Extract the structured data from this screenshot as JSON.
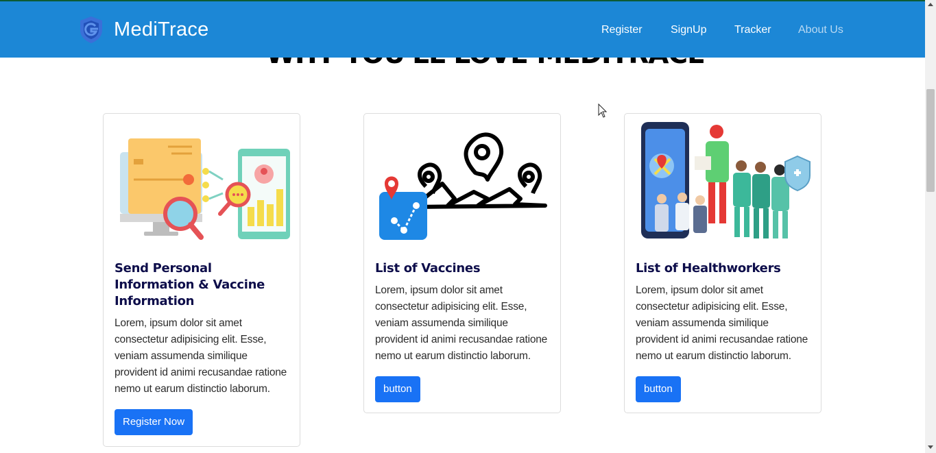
{
  "brand": {
    "name": "MediTrace",
    "logo_icon": "shield-g-logo-icon"
  },
  "nav": {
    "register": "Register",
    "signup": "SignUp",
    "tracker": "Tracker",
    "about": "About Us"
  },
  "section": {
    "heading": "WHY YOU'LL LOVE MEDITRACE"
  },
  "cards": [
    {
      "image_icon": "personal-info-illustration",
      "title": "Send Personal Information & Vaccine Information",
      "text": "Lorem, ipsum dolor sit amet consectetur adipisicing elit. Esse, veniam assumenda similique provident id animi recusandae ratione nemo ut earum distinctio laborum.",
      "button": "Register Now"
    },
    {
      "image_icon": "vaccine-map-pins-illustration",
      "title": "List of Vaccines",
      "text": "Lorem, ipsum dolor sit amet consectetur adipisicing elit. Esse, veniam assumenda similique provident id animi recusandae ratione nemo ut earum distinctio laborum.",
      "button": "button"
    },
    {
      "image_icon": "healthworkers-illustration",
      "title": "List of Healthworkers",
      "text": "Lorem, ipsum dolor sit amet consectetur adipisicing elit. Esse, veniam assumenda similique provident id animi recusandae ratione nemo ut earum distinctio laborum.",
      "button": "button"
    }
  ],
  "colors": {
    "navbar": "#1c87d6",
    "button": "#1972f5",
    "title": "#0d0d4a"
  }
}
